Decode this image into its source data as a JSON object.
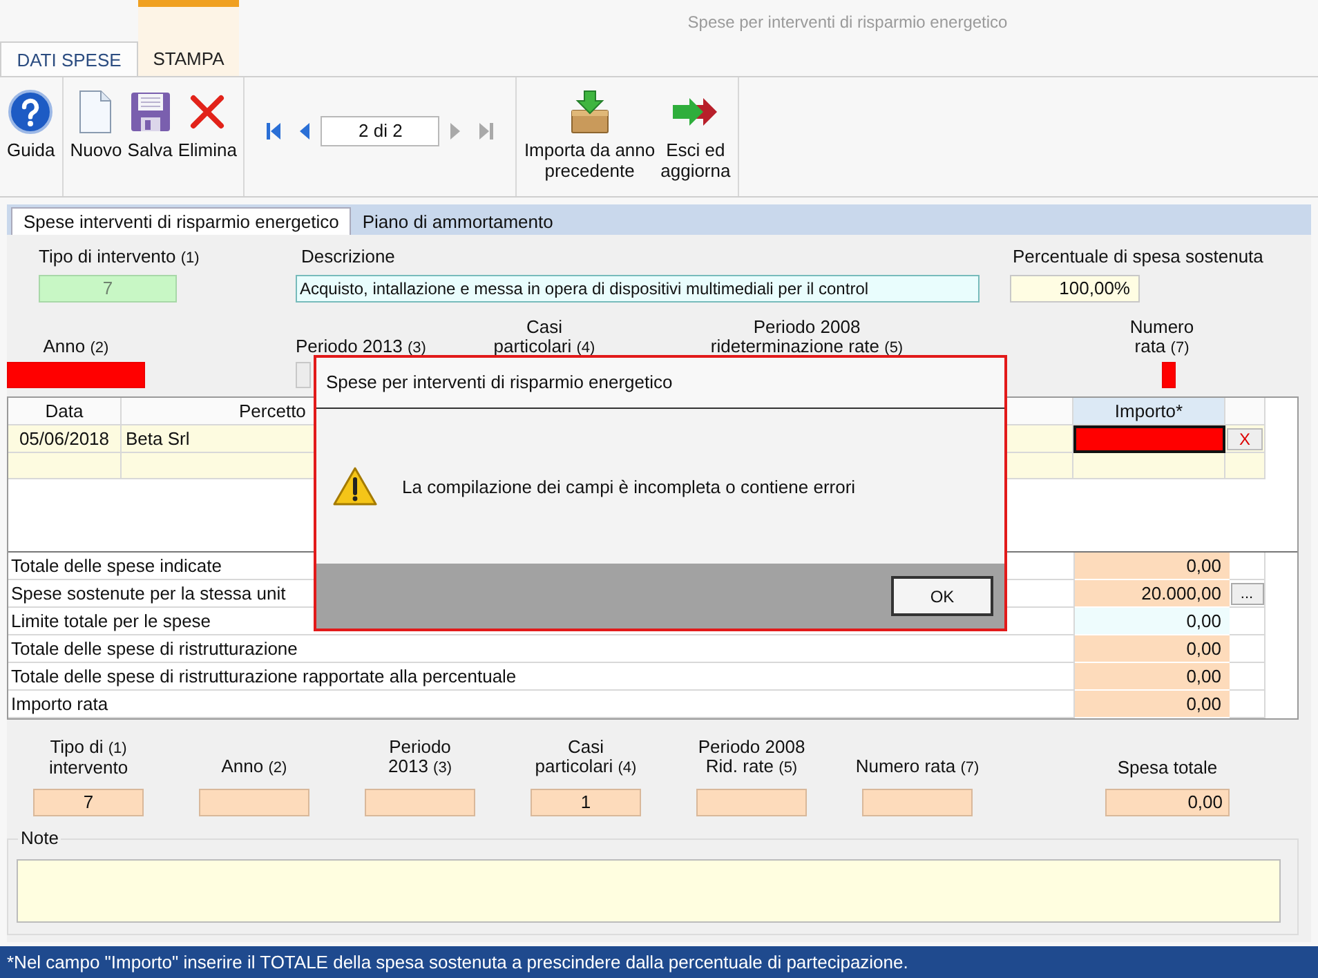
{
  "window": {
    "title": "Spese per interventi di risparmio energetico"
  },
  "ribbon_tabs": [
    {
      "label": "DATI SPESE",
      "selected": true,
      "contextual": false
    },
    {
      "label": "STAMPA",
      "selected": false,
      "contextual": true
    }
  ],
  "toolbar": {
    "groups": [
      {
        "buttons": [
          {
            "kind": "help",
            "label": "Guida"
          }
        ]
      },
      {
        "buttons": [
          {
            "kind": "new",
            "label": "Nuovo"
          },
          {
            "kind": "save",
            "label": "Salva"
          },
          {
            "kind": "delete",
            "label": "Elimina"
          }
        ]
      },
      {
        "navigator": {
          "value": "2 di 2",
          "buttons": [
            {
              "kind": "first",
              "disabled": false
            },
            {
              "kind": "prev",
              "disabled": false
            },
            {
              "kind": "next",
              "disabled": true
            },
            {
              "kind": "last",
              "disabled": true
            }
          ]
        }
      },
      {
        "buttons": [
          {
            "kind": "import",
            "label": "Importa da anno\nprecedente"
          },
          {
            "kind": "exit",
            "label": "Esci ed\naggiorna"
          }
        ]
      }
    ]
  },
  "panel_tabs": [
    {
      "label": "Spese interventi di risparmio energetico",
      "selected": true
    },
    {
      "label": "Piano di ammortamento",
      "selected": false
    }
  ],
  "header_fields": [
    {
      "lines": [
        {
          "text": "Tipo di intervento",
          "ref": "(1)"
        }
      ],
      "value": "7",
      "kind": "readonly"
    },
    {
      "lines": [
        {
          "text": "Descrizione"
        }
      ],
      "value": "Acquisto, intallazione e messa in opera di dispositivi multimediali per il control",
      "kind": "text"
    },
    {
      "lines": [
        {
          "text": "Percentuale di spesa sostenuta"
        }
      ],
      "value": "100,00%",
      "kind": "input"
    }
  ],
  "period_fields": [
    {
      "lines": [
        {
          "text": "Anno",
          "ref": "(2)"
        }
      ],
      "kind": "error"
    },
    {
      "lines": [
        {
          "text": "Periodo 2013",
          "ref": "(3)"
        }
      ],
      "kind": "disabled"
    },
    {
      "lines": [
        {
          "text": "Casi"
        },
        {
          "text": "particolari",
          "ref": "(4)"
        }
      ]
    },
    {
      "lines": [
        {
          "text": "Periodo 2008"
        },
        {
          "text": "rideterminazione rate",
          "ref": "(5)"
        }
      ]
    },
    {
      "lines": [
        {
          "text": "Numero"
        },
        {
          "text": "rata",
          "ref": "(7)"
        }
      ],
      "kind": "error"
    }
  ],
  "table": {
    "columns": [
      "Data",
      "Percetto",
      "Importo*"
    ],
    "rows": [
      {
        "kind": "entry",
        "cells": [
          "05/06/2018",
          "Beta Srl"
        ],
        "importo_error": true,
        "delete_label": "X"
      },
      {
        "kind": "new"
      }
    ]
  },
  "totals": [
    {
      "label": "Totale delle spese indicate",
      "value": "0,00",
      "kind": "computed"
    },
    {
      "label": "Spese sostenute per la stessa unit",
      "value": "20.000,00",
      "kind": "computed",
      "action": "..."
    },
    {
      "label": "Limite totale per le spese",
      "value": "0,00",
      "kind": "info"
    },
    {
      "label": "Totale delle spese di ristrutturazione",
      "value": "0,00",
      "kind": "computed"
    },
    {
      "label": "Totale delle spese di ristrutturazione rapportate alla percentuale",
      "value": "0,00",
      "kind": "computed"
    },
    {
      "label": "Importo rata",
      "value": "0,00",
      "kind": "computed"
    }
  ],
  "summary_fields": [
    {
      "lines": [
        {
          "text": "Tipo di",
          "ref": "(1)"
        },
        {
          "text": "intervento"
        }
      ],
      "value": "7",
      "kind": "code"
    },
    {
      "lines": [
        {
          "text": "Anno",
          "ref": "(2)"
        }
      ],
      "kind": "code"
    },
    {
      "lines": [
        {
          "text": "Periodo"
        },
        {
          "text": "2013",
          "ref": "(3)"
        }
      ],
      "kind": "code"
    },
    {
      "lines": [
        {
          "text": "Casi"
        },
        {
          "text": "particolari",
          "ref": "(4)"
        }
      ],
      "value": "1",
      "kind": "code"
    },
    {
      "lines": [
        {
          "text": "Periodo 2008"
        },
        {
          "text": "Rid. rate",
          "ref": "(5)"
        }
      ],
      "kind": "code"
    },
    {
      "lines": [
        {
          "text": "Numero rata",
          "ref": "(7)"
        }
      ],
      "kind": "code"
    },
    {
      "lines": [
        {
          "text": "Spesa totale"
        }
      ],
      "value": "0,00",
      "kind": "amount"
    }
  ],
  "note": {
    "label": "Note"
  },
  "footer": "*Nel campo \"Importo\" inserire il TOTALE della spesa sostenuta a prescindere dalla percentuale di partecipazione.",
  "dialog": {
    "title": "Spese per interventi di risparmio energetico",
    "message": "La compilazione dei campi è incompleta o contiene errori",
    "button": "OK"
  }
}
